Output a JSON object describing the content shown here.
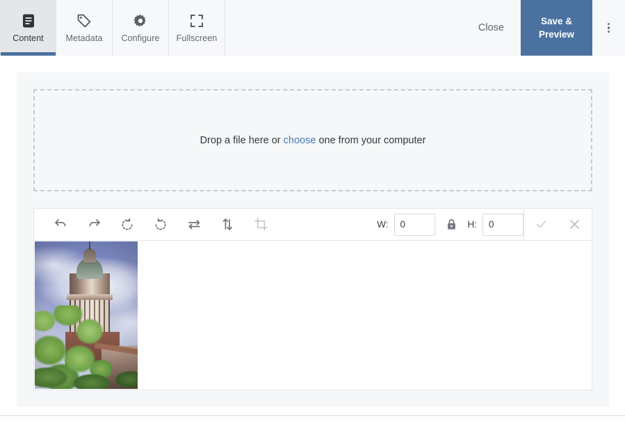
{
  "header": {
    "tabs": [
      {
        "label": "Content",
        "icon": "document-icon",
        "active": true
      },
      {
        "label": "Metadata",
        "icon": "tag-icon",
        "active": false
      },
      {
        "label": "Configure",
        "icon": "gear-icon",
        "active": false
      },
      {
        "label": "Fullscreen",
        "icon": "fullscreen-icon",
        "active": false
      }
    ],
    "close_label": "Close",
    "save_label_line1": "Save &",
    "save_label_line2": "Preview",
    "save_button_color": "#4b71a0",
    "overflow_icon": "kebab-menu-icon"
  },
  "dropzone": {
    "text_before": "Drop a file here or ",
    "link_text": "choose",
    "text_after": " one from your computer",
    "link_color": "#4b7ab5"
  },
  "editor": {
    "tools": [
      {
        "name": "undo-icon",
        "label": "Undo",
        "disabled": false
      },
      {
        "name": "redo-icon",
        "label": "Redo",
        "disabled": false
      },
      {
        "name": "rotate-left-icon",
        "label": "Rotate left",
        "disabled": false
      },
      {
        "name": "rotate-right-icon",
        "label": "Rotate right",
        "disabled": false
      },
      {
        "name": "flip-horizontal-icon",
        "label": "Flip horizontal",
        "disabled": false
      },
      {
        "name": "flip-vertical-icon",
        "label": "Flip vertical",
        "disabled": false
      },
      {
        "name": "crop-icon",
        "label": "Crop",
        "disabled": true
      }
    ],
    "width_label": "W:",
    "width_value": "0",
    "height_label": "H:",
    "height_value": "0",
    "lock_icon": "lock-closed-icon",
    "confirm_icon": "check-icon",
    "cancel_icon": "close-icon",
    "image_alt": "Photograph of a domed library tower surrounded by green trees under a blue cloudy sky"
  }
}
